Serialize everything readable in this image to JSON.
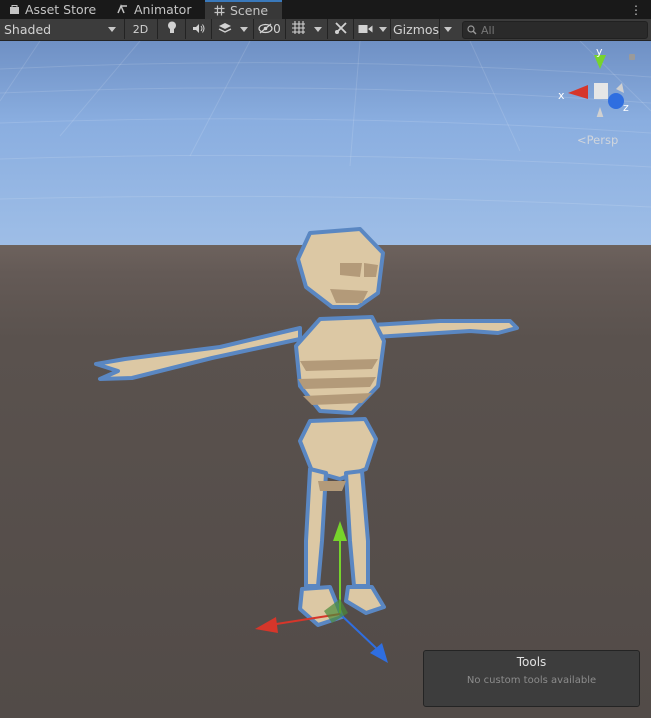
{
  "tabs": [
    {
      "label": "Asset Store",
      "icon": "bag-icon"
    },
    {
      "label": "Animator",
      "icon": "animator-icon"
    },
    {
      "label": "Scene",
      "icon": "grid-hash-icon",
      "active": true
    }
  ],
  "toolbar": {
    "draw_mode": "Shaded",
    "mode_2d": "2D",
    "hidden_count": "0",
    "gizmos": "Gizmos",
    "search_placeholder": "All"
  },
  "scene": {
    "projection": "Persp",
    "axis_labels": {
      "x": "x",
      "y": "y",
      "z": "z"
    }
  },
  "tools_panel": {
    "title": "Tools",
    "message": "No custom tools available"
  },
  "colors": {
    "active_tab_accent": "#3a79bb",
    "x_axis": "#d6362a",
    "y_axis": "#77d42b",
    "z_axis": "#2f6ee0",
    "selection_outline": "#5a87c2"
  }
}
